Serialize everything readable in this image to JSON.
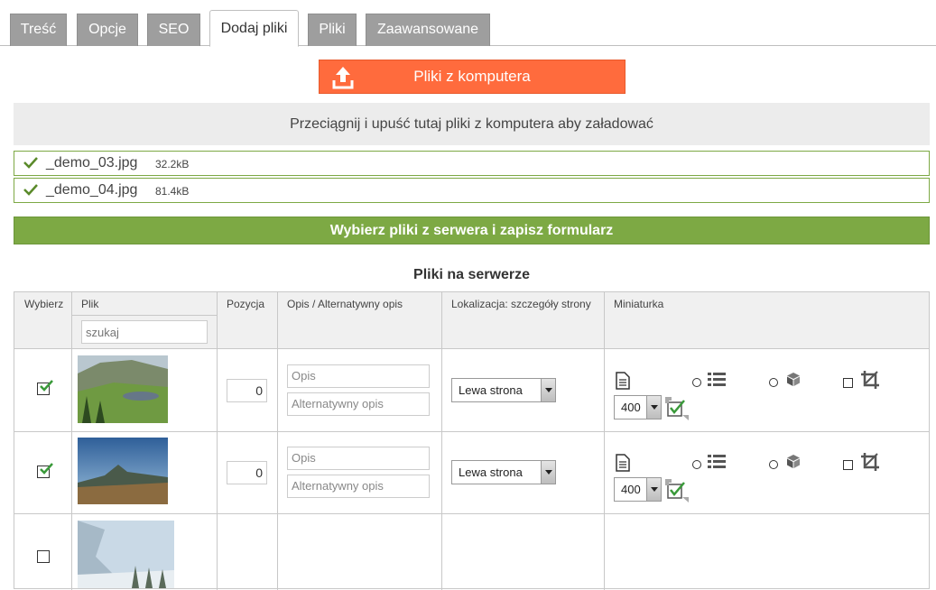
{
  "tabs": [
    "Treść",
    "Opcje",
    "SEO",
    "Dodaj pliki",
    "Pliki",
    "Zaawansowane"
  ],
  "upload": {
    "button_label": "Pliki z komputera",
    "dropzone_text": "Przeciągnij i upuść tutaj pliki z komputera aby załadować"
  },
  "uploaded_files": [
    {
      "name": "_demo_03.jpg",
      "size": "32.2kB"
    },
    {
      "name": "_demo_04.jpg",
      "size": "81.4kB"
    }
  ],
  "select_button_label": "Wybierz pliki z serwera i zapisz formularz",
  "section_title": "Pliki na serwerze",
  "table": {
    "headers": {
      "select": "Wybierz",
      "file": "Plik",
      "position": "Pozycja",
      "description": "Opis / Alternatywny opis",
      "location": "Lokalizacja: szczegóły strony",
      "thumbnail": "Miniaturka"
    },
    "search_placeholder": "szukaj",
    "desc_placeholder": "Opis",
    "alt_placeholder": "Alternatywny opis",
    "rows": [
      {
        "checked": true,
        "position": "0",
        "location": "Lewa strona",
        "thumb_size": "400"
      },
      {
        "checked": true,
        "position": "0",
        "location": "Lewa strona",
        "thumb_size": "400"
      },
      {
        "checked": false
      }
    ]
  },
  "colors": {
    "accent_orange": "#ff6b3d",
    "accent_green": "#7da944",
    "tab_gray": "#9e9e9e"
  }
}
